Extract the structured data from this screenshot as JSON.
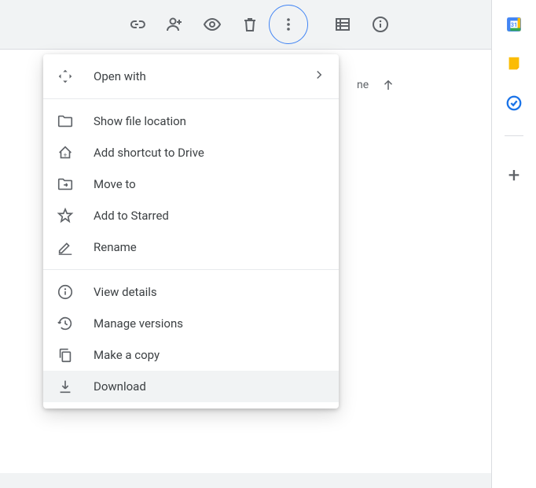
{
  "menu": {
    "open_with": "Open with",
    "show_file_location": "Show file location",
    "add_shortcut": "Add shortcut to Drive",
    "move_to": "Move to",
    "add_starred": "Add to Starred",
    "rename": "Rename",
    "view_details": "View details",
    "manage_versions": "Manage versions",
    "make_copy": "Make a copy",
    "download": "Download"
  },
  "partial_text": "ne",
  "toolbar_icons": [
    "link",
    "share",
    "preview",
    "remove",
    "more",
    "list",
    "details"
  ],
  "side_icons": [
    "calendar",
    "keep",
    "tasks"
  ],
  "calendar_day": "31"
}
